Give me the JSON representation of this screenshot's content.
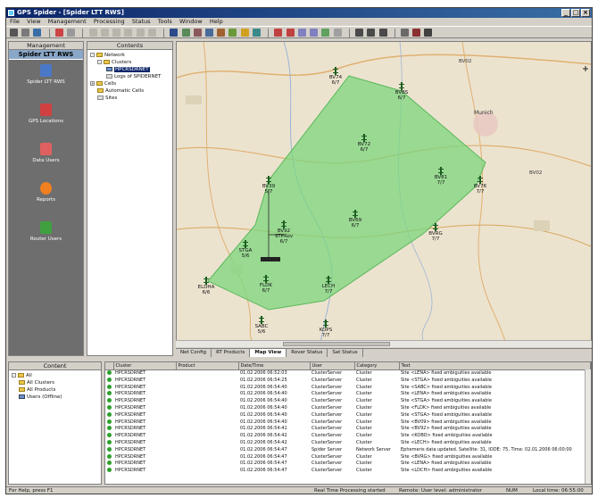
{
  "window": {
    "title": "GPS Spider - [Spider LTT RWS]",
    "min": "_",
    "max": "□",
    "close": "×"
  },
  "menu": [
    "File",
    "View",
    "Management",
    "Processing",
    "Status",
    "Tools",
    "Window",
    "Help"
  ],
  "management": {
    "header": "Management",
    "title": "Spider LTT RWS",
    "items": [
      {
        "label": "Spider LTT RWS",
        "icon": "server-icon",
        "color": "#4a78c8"
      },
      {
        "label": "GPS Locations",
        "icon": "gps-location-icon",
        "color": "#d04040"
      },
      {
        "label": "Data Users",
        "icon": "users-icon",
        "color": "#e06060"
      },
      {
        "label": "Reports",
        "icon": "alarm-icon",
        "color": "#f08020"
      },
      {
        "label": "Router Users",
        "icon": "battery-icon",
        "color": "#40a040"
      }
    ]
  },
  "contents": {
    "header": "Contents",
    "tree": [
      {
        "label": "Network",
        "level": 0
      },
      {
        "label": "Clusters",
        "level": 1
      },
      {
        "label": "HPCRSDRNET",
        "level": 2
      },
      {
        "label": "Logs of SPIDERNET",
        "level": 2
      },
      {
        "label": "Cells",
        "level": 0
      },
      {
        "label": "Automatic Cells",
        "level": 0
      },
      {
        "label": "Sites",
        "level": 0
      }
    ]
  },
  "map": {
    "labels": [
      {
        "text": "BV02"
      },
      {
        "text": "Munich"
      },
      {
        "text": "BV02"
      }
    ],
    "stations": [
      {
        "name": "BV74",
        "status": "6/7"
      },
      {
        "name": "BVBS",
        "status": "6/7"
      },
      {
        "name": "BV72",
        "status": "6/7"
      },
      {
        "name": "BV81",
        "status": "7/7"
      },
      {
        "name": "BV76",
        "status": "7/7"
      },
      {
        "name": "BV39",
        "status": "5/7"
      },
      {
        "name": "BV69",
        "status": "6/7"
      },
      {
        "name": "BV92",
        "status": "6/7"
      },
      {
        "name": "STGA",
        "status": "5/6"
      },
      {
        "name": "BVRG",
        "status": "7/7"
      },
      {
        "name": "FLDK",
        "status": "6/7"
      },
      {
        "name": "LECH",
        "status": "7/7"
      },
      {
        "name": "ELDHA",
        "status": "6/6"
      },
      {
        "name": "SABC",
        "status": "5/6"
      },
      {
        "name": "KOPS",
        "status": "7/7"
      }
    ],
    "rover_label": "STPRov",
    "rover_status": "5/7"
  },
  "tabs": [
    "Net Config",
    "RT Products",
    "Map View",
    "Rover Status",
    "Sat Status"
  ],
  "active_tab": "Map View",
  "lower_left": {
    "header": "Content",
    "tree": [
      "All",
      "All Clusters",
      "All Products",
      "Users (Offline)"
    ]
  },
  "log": {
    "columns": [
      "",
      "Cluster",
      "Product",
      "Date/Time",
      "User",
      "Category",
      "Text"
    ],
    "rows": [
      {
        "cluster": "HPCRSDRNET",
        "date": "01.02.2006 06:52:03",
        "user": "ClusterServer",
        "category": "Cluster",
        "text": "Site <LENA> fixed ambiguities available"
      },
      {
        "cluster": "HPCRSDRNET",
        "date": "01.02.2006 06:54:25",
        "user": "ClusterServer",
        "category": "Cluster",
        "text": "Site <STGA> fixed ambiguities available"
      },
      {
        "cluster": "HPCRSDRNET",
        "date": "01.02.2006 06:54:40",
        "user": "ClusterServer",
        "category": "Cluster",
        "text": "Site <SABC> fixed ambiguities available"
      },
      {
        "cluster": "HPCRSDRNET",
        "date": "01.02.2006 06:54:40",
        "user": "ClusterServer",
        "category": "Cluster",
        "text": "Site <LENA> fixed ambiguities available"
      },
      {
        "cluster": "HPCRSDRNET",
        "date": "01.02.2006 06:54:40",
        "user": "ClusterServer",
        "category": "Cluster",
        "text": "Site <STGA> fixed ambiguities available"
      },
      {
        "cluster": "HPCRSDRNET",
        "date": "01.02.2006 06:54:40",
        "user": "ClusterServer",
        "category": "Cluster",
        "text": "Site <FLDK> fixed ambiguities available"
      },
      {
        "cluster": "HPCRSDRNET",
        "date": "01.02.2006 06:54:40",
        "user": "ClusterServer",
        "category": "Cluster",
        "text": "Site <STGA> fixed ambiguities available"
      },
      {
        "cluster": "HPCRSDRNET",
        "date": "01.02.2006 06:54:40",
        "user": "ClusterServer",
        "category": "Cluster",
        "text": "Site <BV09> fixed ambiguities available"
      },
      {
        "cluster": "HPCRSDRNET",
        "date": "01.02.2006 06:54:41",
        "user": "ClusterServer",
        "category": "Cluster",
        "text": "Site <BV92> fixed ambiguities available"
      },
      {
        "cluster": "HPCRSDRNET",
        "date": "01.02.2006 06:54:42",
        "user": "ClusterServer",
        "category": "Cluster",
        "text": "Site <KOBO> fixed ambiguities available"
      },
      {
        "cluster": "HPCRSDRNET",
        "date": "01.02.2006 06:54:42",
        "user": "ClusterServer",
        "category": "Cluster",
        "text": "Site <LECH> fixed ambiguities available"
      },
      {
        "cluster": "HPCRSDRNET",
        "date": "01.02.2006 06:54:47",
        "user": "Spider Server",
        "category": "Network Server",
        "text": "Ephemeris data updated. Satellite: 31, IODE: 75, Time: 02.01.2006 06:00:00"
      },
      {
        "cluster": "HPCRSDRNET",
        "date": "01.02.2006 06:54:47",
        "user": "ClusterServer",
        "category": "Cluster",
        "text": "Site <BVRG> fixed ambiguities available"
      },
      {
        "cluster": "HPCRSDRNET",
        "date": "01.02.2006 06:54:47",
        "user": "ClusterServer",
        "category": "Cluster",
        "text": "Site <LENA> fixed ambiguities available"
      },
      {
        "cluster": "HPCRSDRNET",
        "date": "01.02.2006 06:54:47",
        "user": "ClusterServer",
        "category": "Cluster",
        "text": "Site <LDCH> fixed ambiguities available"
      }
    ]
  },
  "status": {
    "help": "For Help, press F1",
    "processing": "Real Time Processing started",
    "remote": "Remote: User level: administrator",
    "num": "NUM",
    "time": "Local time: 06:55:00"
  }
}
